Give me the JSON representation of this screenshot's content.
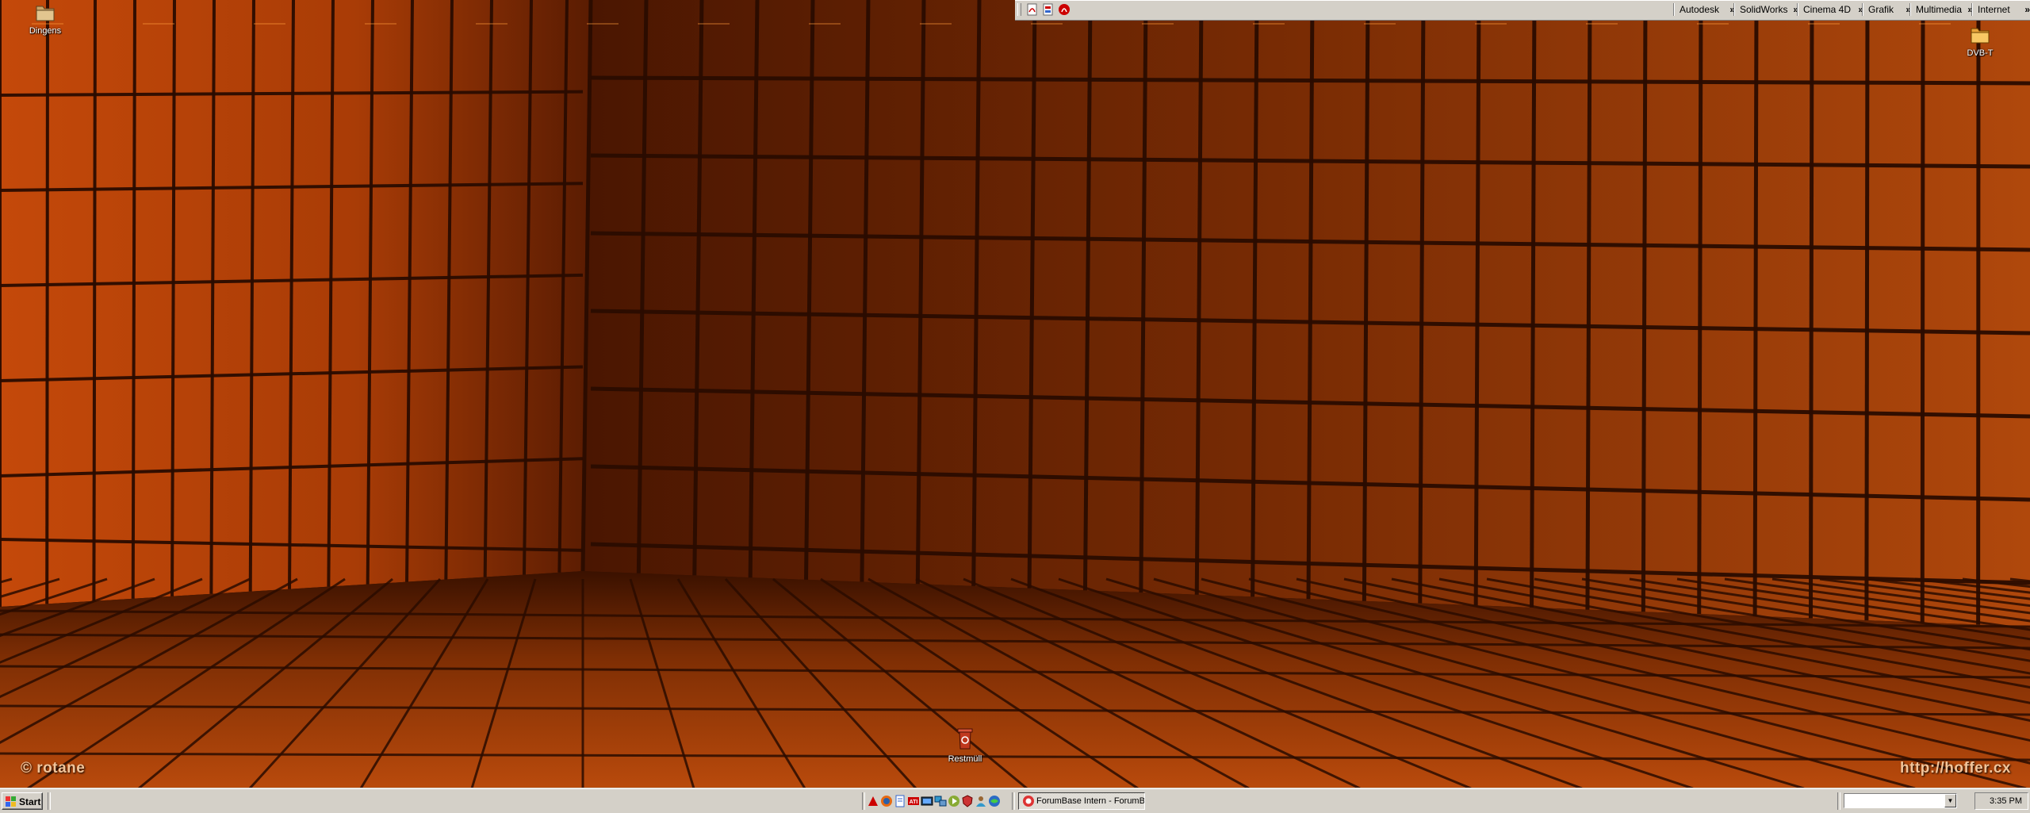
{
  "desktop": {
    "icons": {
      "dingens": "Dingens",
      "dvbt": "DVB-T",
      "restmuell": "Restmüll"
    },
    "watermark_left": "© rotane",
    "watermark_right": "http://hoffer.cx",
    "wallpaper_colors": {
      "deep": "#2a0c00",
      "mid": "#8a3100",
      "bright": "#e8691a",
      "highlight": "#ff9a3c"
    }
  },
  "topbar": {
    "quick_icons": [
      "acrobat-icon",
      "pdf-tool-icon",
      "acrobat-reader-icon"
    ],
    "menus": [
      "Autodesk",
      "SolidWorks",
      "Cinema 4D",
      "Grafik",
      "Multimedia",
      "Internet"
    ],
    "chevron": "»"
  },
  "taskbar": {
    "start_label": "Start",
    "quick_launch_icons": [
      "adobe-icon",
      "firefox-icon",
      "notepad-icon",
      "ati-icon",
      "tv-icon",
      "network-icon",
      "media-icon",
      "security-icon",
      "user-icon",
      "globe-icon"
    ],
    "task_button": "ForumBase Intern - ForumB...",
    "address_value": "",
    "clock": "3:35 PM"
  }
}
